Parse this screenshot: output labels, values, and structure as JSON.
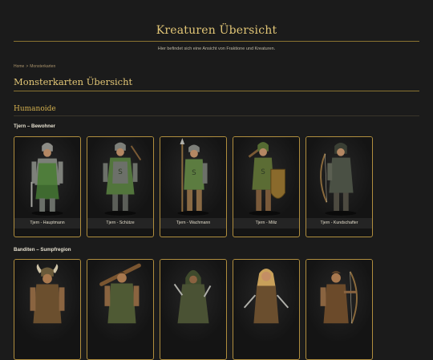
{
  "header": {
    "title": "Kreaturen Übersicht",
    "subtitle": "Hier befindet sich eine Ansicht von Fraktione und Kreaturen."
  },
  "breadcrumb": {
    "home": "Home",
    "separator": ">",
    "current": "Monsterkarten"
  },
  "page": {
    "title": "Monsterkarten Übersicht"
  },
  "section": {
    "title": "Humanoide"
  },
  "groups": [
    {
      "title": "Tjern – Bewohner",
      "cards": [
        {
          "label": "Tjern - Hauptmann",
          "icon": "armored-captain-icon"
        },
        {
          "label": "Tjern - Schütze",
          "icon": "archer-icon"
        },
        {
          "label": "Tjern - Wachmann",
          "icon": "spear-guard-icon"
        },
        {
          "label": "Tjern - Miliz",
          "icon": "militia-shield-icon"
        },
        {
          "label": "Tjern - Kundschafter",
          "icon": "scout-bow-icon"
        }
      ]
    },
    {
      "title": "Banditen – Sumpfregion",
      "cards": [
        {
          "label": "",
          "icon": "horned-bandit-icon"
        },
        {
          "label": "",
          "icon": "club-bandit-icon"
        },
        {
          "label": "",
          "icon": "hooded-bandit-icon"
        },
        {
          "label": "",
          "icon": "blonde-bandit-icon"
        },
        {
          "label": "",
          "icon": "bow-bandit-icon"
        }
      ]
    }
  ],
  "colors": {
    "accent": "#e2c676",
    "card_border": "#b08e3e",
    "background": "#1b1b1b"
  }
}
